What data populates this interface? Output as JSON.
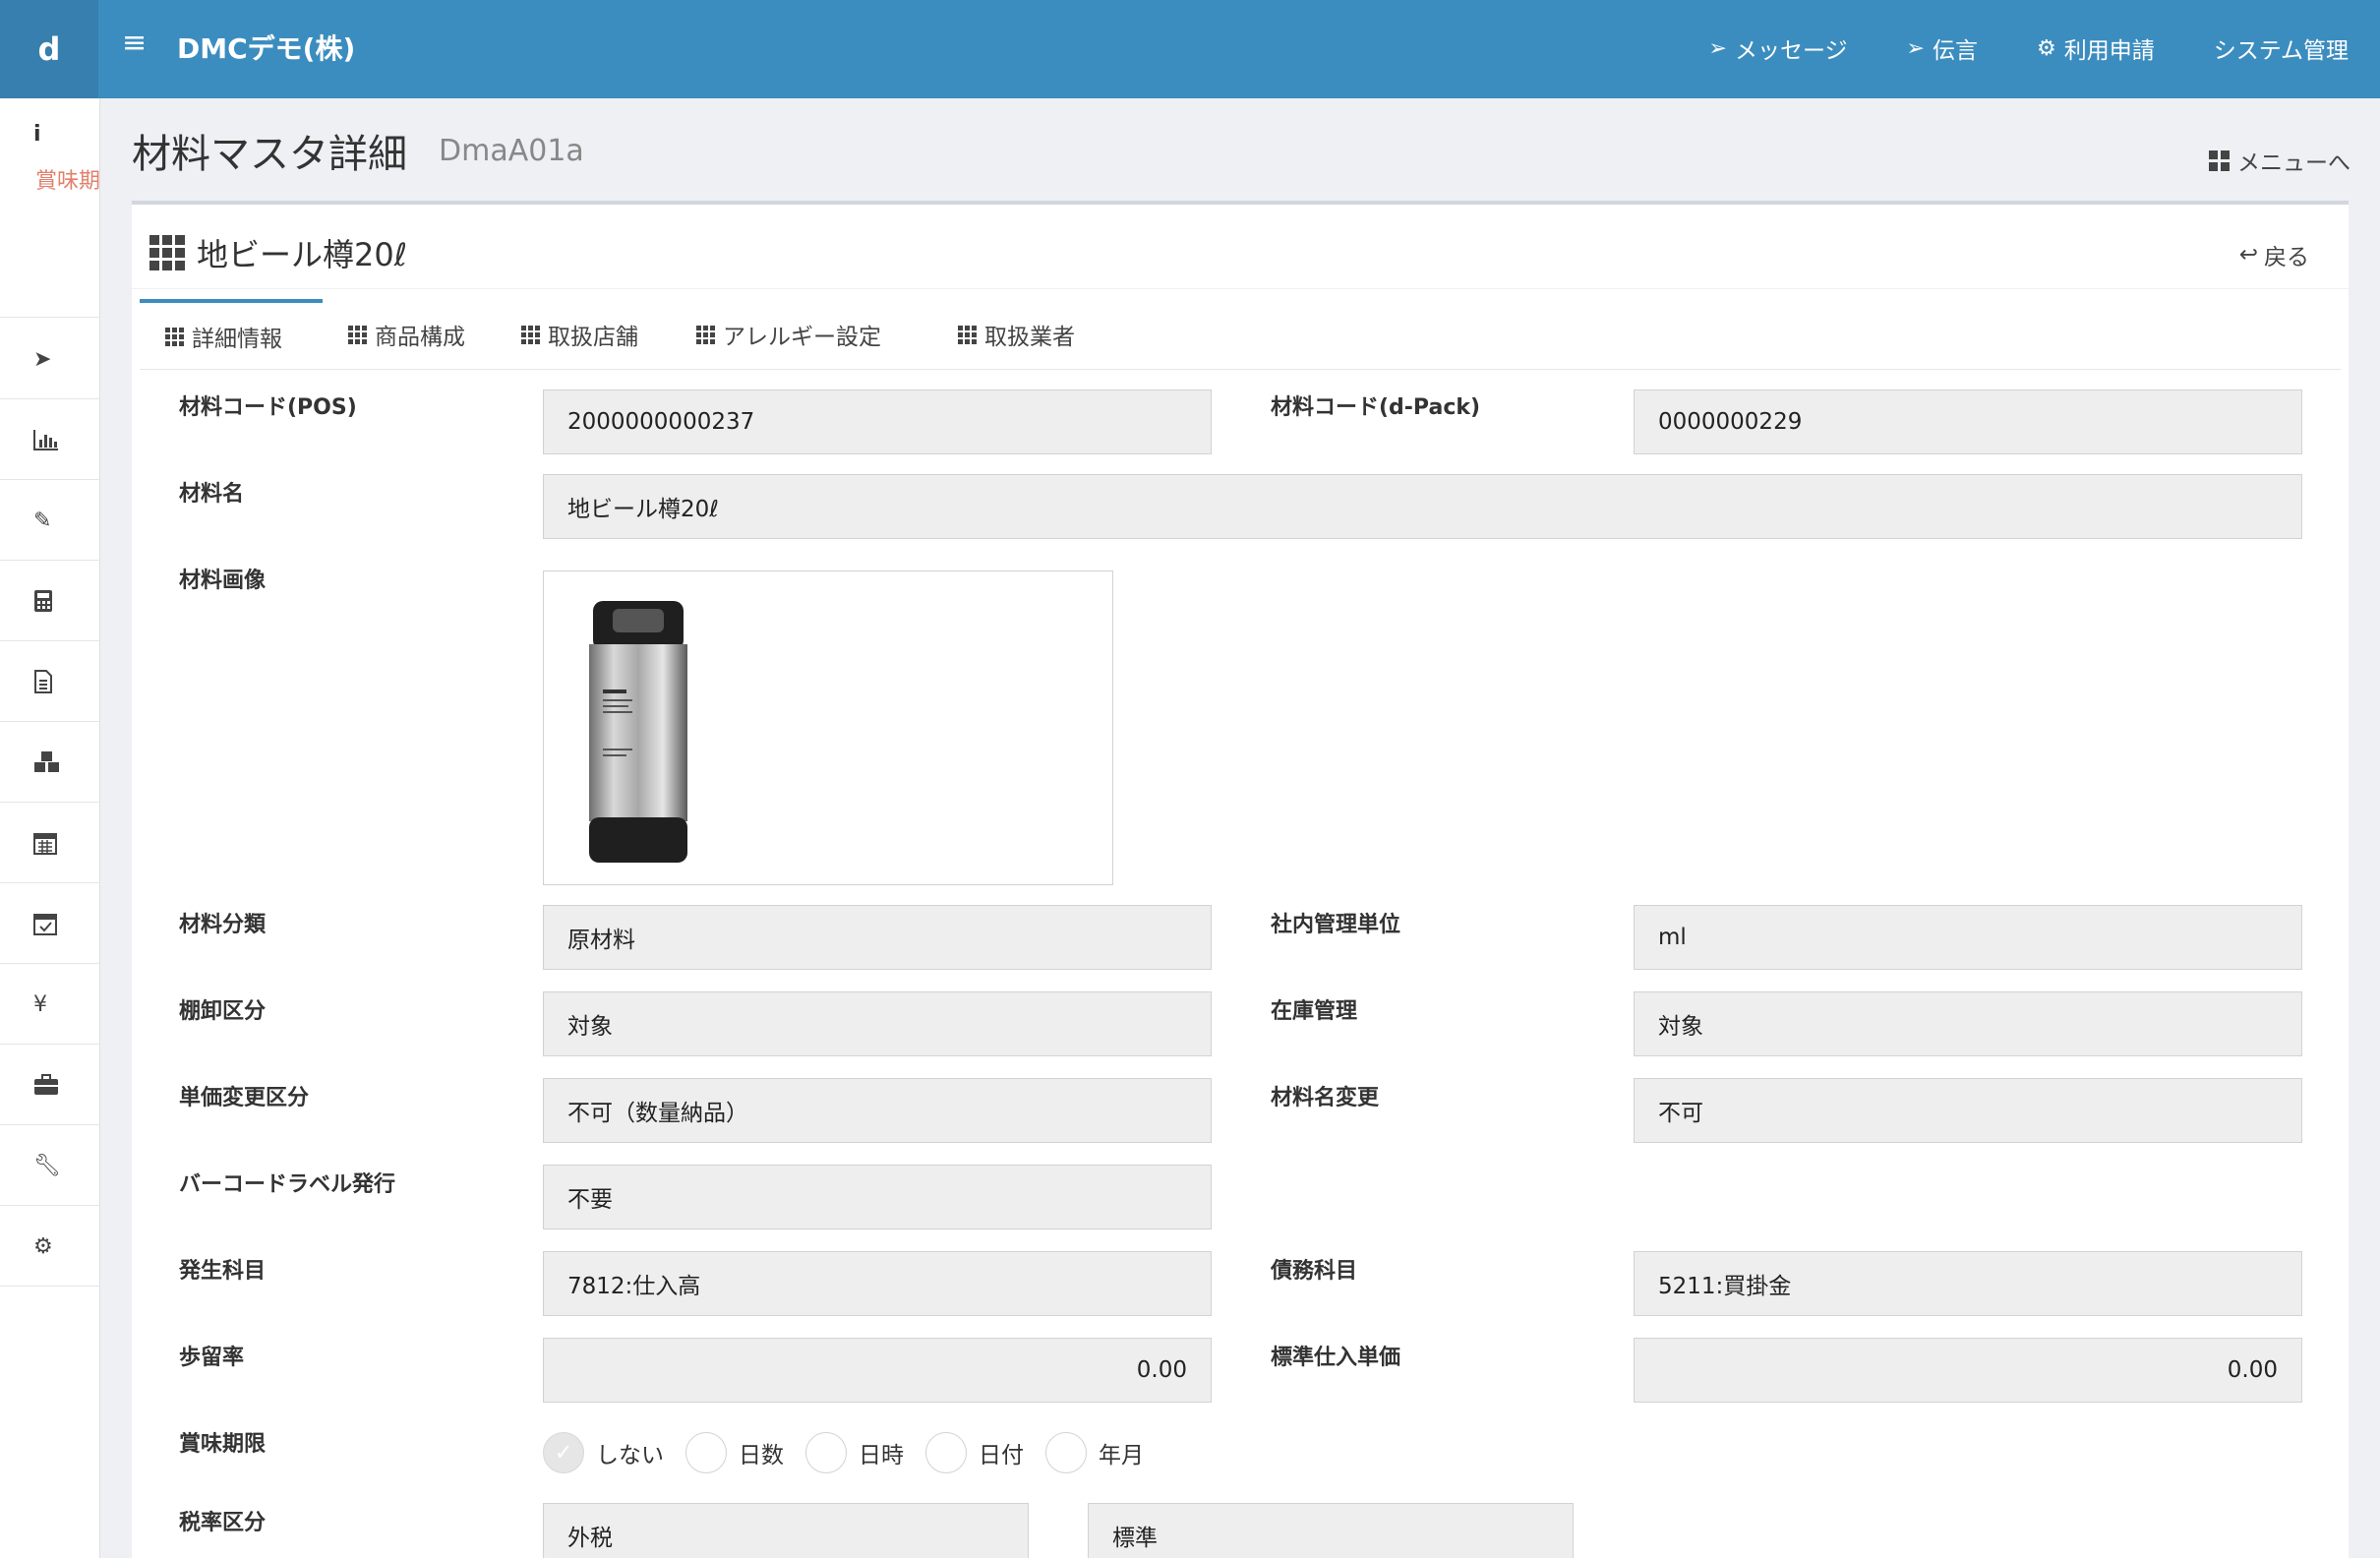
{
  "topbar": {
    "logo": "d",
    "company": "DMCデモ(株)",
    "nav": [
      {
        "label": "メッセージ",
        "icon": "paper-plane-icon"
      },
      {
        "label": "伝言",
        "icon": "paper-plane-outline-icon"
      },
      {
        "label": "利用申請",
        "icon": "gear-icon"
      },
      {
        "label": "システム管理",
        "icon": ""
      }
    ]
  },
  "sidebar": {
    "info_icon": "i",
    "info_text": "賞味期限",
    "items": [
      "send-icon",
      "bar-chart-icon",
      "edit-icon",
      "calculator-icon",
      "document-icon",
      "cubes-icon",
      "calendar-icon",
      "calendar-check-icon",
      "yen-icon",
      "briefcase-icon",
      "wrench-icon",
      "gears-icon"
    ]
  },
  "header": {
    "title": "材料マスタ詳細",
    "code": "DmaA01a",
    "menu_link": "メニューへ"
  },
  "card": {
    "title": "地ビール樽20ℓ",
    "back": "戻る"
  },
  "tabs": [
    {
      "label": "詳細情報",
      "active": true
    },
    {
      "label": "商品構成",
      "active": false
    },
    {
      "label": "取扱店舗",
      "active": false
    },
    {
      "label": "アレルギー設定",
      "active": false
    },
    {
      "label": "取扱業者",
      "active": false
    }
  ],
  "form": {
    "code_pos_label": "材料コード(POS)",
    "code_pos": "2000000000237",
    "code_dpack_label": "材料コード(d-Pack)",
    "code_dpack": "0000000229",
    "name_label": "材料名",
    "name": "地ビール樽20ℓ",
    "image_label": "材料画像",
    "category_label": "材料分類",
    "category": "原材料",
    "unit_label": "社内管理単位",
    "unit": "ml",
    "inventory_label": "棚卸区分",
    "inventory": "対象",
    "stock_label": "在庫管理",
    "stock": "対象",
    "price_change_label": "単価変更区分",
    "price_change": "不可（数量納品）",
    "name_change_label": "材料名変更",
    "name_change": "不可",
    "barcode_label": "バーコードラベル発行",
    "barcode": "不要",
    "debit_label": "発生科目",
    "debit": "7812:仕入高",
    "credit_label": "債務科目",
    "credit": "5211:買掛金",
    "yield_label": "歩留率",
    "yield": "0.00",
    "std_price_label": "標準仕入単価",
    "std_price": "0.00",
    "expiry_label": "賞味期限",
    "expiry_options": [
      "しない",
      "日数",
      "日時",
      "日付",
      "年月"
    ],
    "expiry_selected": "しない",
    "tax_label": "税率区分",
    "tax_type": "外税",
    "tax_rate": "標準"
  },
  "colors": {
    "topbar": "#3c8dbf",
    "logo_bg": "#367fae",
    "warn_text": "#e2806b"
  }
}
